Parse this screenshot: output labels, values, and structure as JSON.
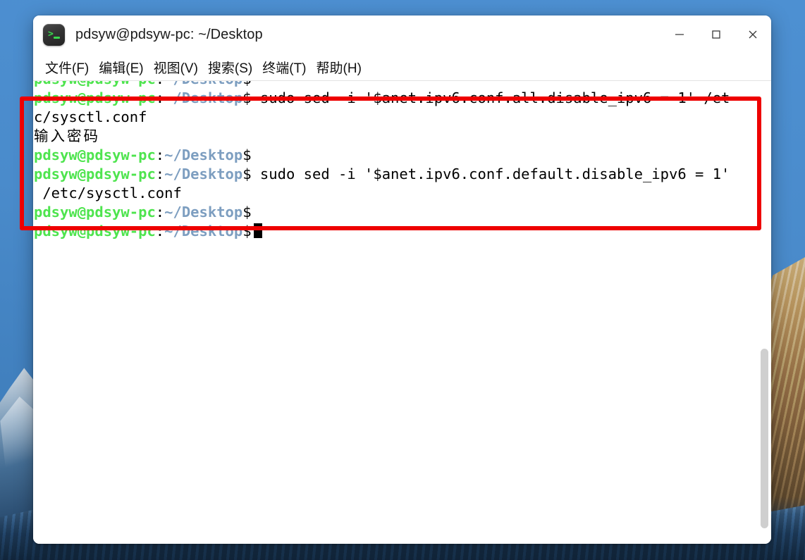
{
  "window": {
    "title": "pdsyw@pdsyw-pc: ~/Desktop",
    "app_icon": "terminal-prompt-icon",
    "controls": {
      "minimize": "–",
      "maximize": "□",
      "close": "✕"
    }
  },
  "menubar": {
    "items": [
      {
        "label": "文件(F)"
      },
      {
        "label": "编辑(E)"
      },
      {
        "label": "视图(V)"
      },
      {
        "label": "搜索(S)"
      },
      {
        "label": "终端(T)"
      },
      {
        "label": "帮助(H)"
      }
    ]
  },
  "terminal": {
    "prompt": {
      "user_host": "pdsyw@pdsyw-pc",
      "colon": ":",
      "path": "~/Desktop",
      "dollar": "$"
    },
    "lines": [
      {
        "type": "prompt",
        "command": ""
      },
      {
        "type": "prompt",
        "command": " sudo sed -i '$anet.ipv6.conf.all.disable_ipv6 = 1' /et"
      },
      {
        "type": "output",
        "text": "c/sysctl.conf"
      },
      {
        "type": "output_cjk",
        "text": "输入密码"
      },
      {
        "type": "prompt",
        "command": ""
      },
      {
        "type": "prompt",
        "command": " sudo sed -i '$anet.ipv6.conf.default.disable_ipv6 = 1'"
      },
      {
        "type": "output",
        "text": " /etc/sysctl.conf"
      },
      {
        "type": "prompt",
        "command": ""
      },
      {
        "type": "prompt_cursor",
        "command": ""
      }
    ]
  },
  "annotation": {
    "shape": "rectangle",
    "color": "#ee0000",
    "highlights_lines": "the two sudo sed commands and their output"
  },
  "colors": {
    "prompt_user": "#4ee44e",
    "prompt_path": "#7d9ec0",
    "terminal_bg": "#ffffff",
    "terminal_fg": "#000000",
    "annotation_red": "#ee0000",
    "titlebar_bg": "#ffffff"
  }
}
